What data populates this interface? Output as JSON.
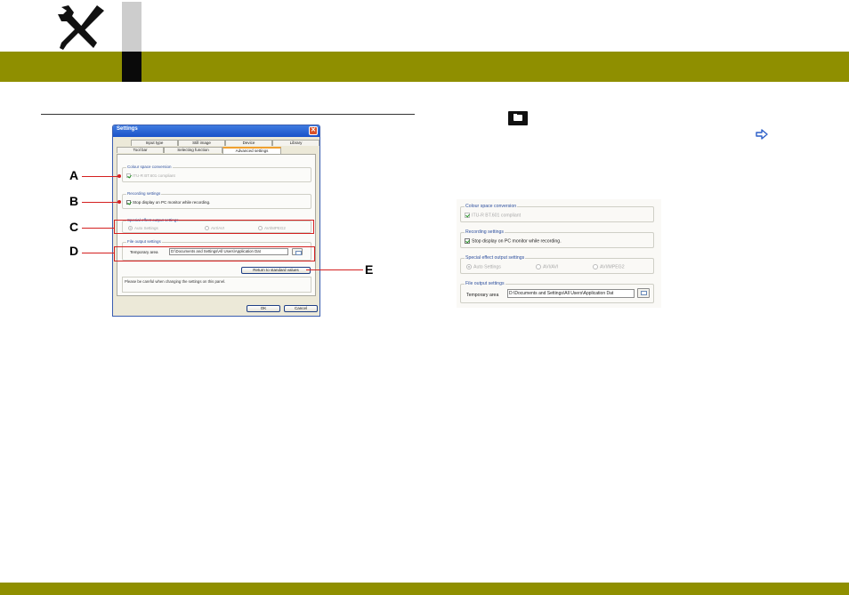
{
  "dialog": {
    "title": "Settings",
    "close_glyph": "✕",
    "tabs_row1": [
      "Input type",
      "Still image",
      "Device",
      "Library"
    ],
    "tabs_row2": [
      "Tool bar",
      "Selecting function",
      "Advanced settings"
    ],
    "active_tab": "Advanced settings",
    "groups": {
      "colour": {
        "title": "Colour space conversion",
        "option": "ITU-R BT.601 compliant",
        "checked": true,
        "enabled": false
      },
      "recording": {
        "title": "Recording settings",
        "option": "Stop display on PC monitor while recording.",
        "checked": true,
        "enabled": true
      },
      "special": {
        "title": "Special effect output settings",
        "options": [
          "Auto Settings",
          "AVI/AVI",
          "AVI/MPEG2"
        ],
        "selected": "Auto Settings",
        "enabled": false
      },
      "file": {
        "title": "File output settings",
        "label": "Temporary area",
        "path": "D:\\Documents and Settings\\All Users\\Application Dat"
      }
    },
    "return_button": "Return to standard values",
    "description": "Please be careful when changing the settings on this panel.",
    "ok_button": "OK",
    "cancel_button": "Cancel"
  },
  "callouts": [
    "A",
    "B",
    "C",
    "D",
    "E"
  ],
  "zoom": {
    "colour": {
      "title": "Colour space conversion",
      "option": "ITU-R BT.601 compliant"
    },
    "recording": {
      "title": "Recording settings",
      "option": "Stop display on PC monitor while recording."
    },
    "special": {
      "title": "Special effect output settings",
      "options": [
        "Auto Settings",
        "AVI/AVI",
        "AVI/MPEG2"
      ]
    },
    "file": {
      "title": "File output settings",
      "label": "Temporary area",
      "path": "D:\\Documents and Settings\\All Users\\Application Dat"
    }
  },
  "icons": {
    "header": "tools-icon",
    "folder": "folder-icon",
    "arrow": "arrow-right-icon"
  },
  "colors": {
    "band": "#8f8f00",
    "accent_red": "#d42020",
    "strip_gray": "#cdcdcd",
    "strip_black": "#0a0a0a"
  }
}
